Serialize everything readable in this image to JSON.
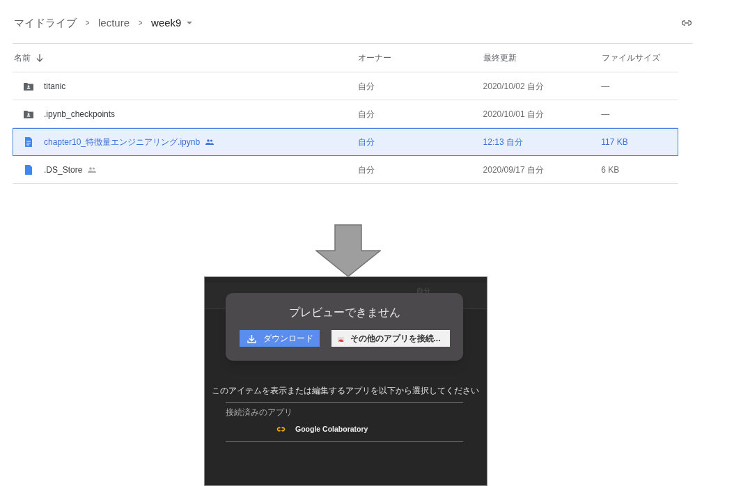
{
  "breadcrumb": {
    "items": [
      "マイドライブ",
      "lecture",
      "week9"
    ],
    "separator": ">"
  },
  "table": {
    "columns": [
      "名前",
      "オーナー",
      "最終更新",
      "ファイルサイズ"
    ],
    "rows": [
      {
        "kind": "folder",
        "name": "titanic",
        "shared": false,
        "owner": "自分",
        "modified": "2020/10/02 自分",
        "size": "—",
        "selected": false
      },
      {
        "kind": "folder",
        "name": ".ipynb_checkpoints",
        "shared": false,
        "owner": "自分",
        "modified": "2020/10/01 自分",
        "size": "—",
        "selected": false
      },
      {
        "kind": "file",
        "name": "chapter10_特徴量エンジニアリング.ipynb",
        "shared": true,
        "owner": "自分",
        "modified": "12:13 自分",
        "size": "117 KB",
        "selected": true
      },
      {
        "kind": "file",
        "name": ".DS_Store",
        "shared": true,
        "owner": "自分",
        "modified": "2020/09/17 自分",
        "size": "6 KB",
        "selected": false
      }
    ]
  },
  "preview": {
    "background_text": "自分",
    "title": "プレビューできません",
    "download_button": "ダウンロード",
    "connect_button": "その他のアプリを接続...",
    "prompt": "このアイテムを表示または編集するアプリを以下から選択してください",
    "connected_label": "接続済みのアプリ",
    "apps": [
      "Google Colaboratory"
    ]
  }
}
